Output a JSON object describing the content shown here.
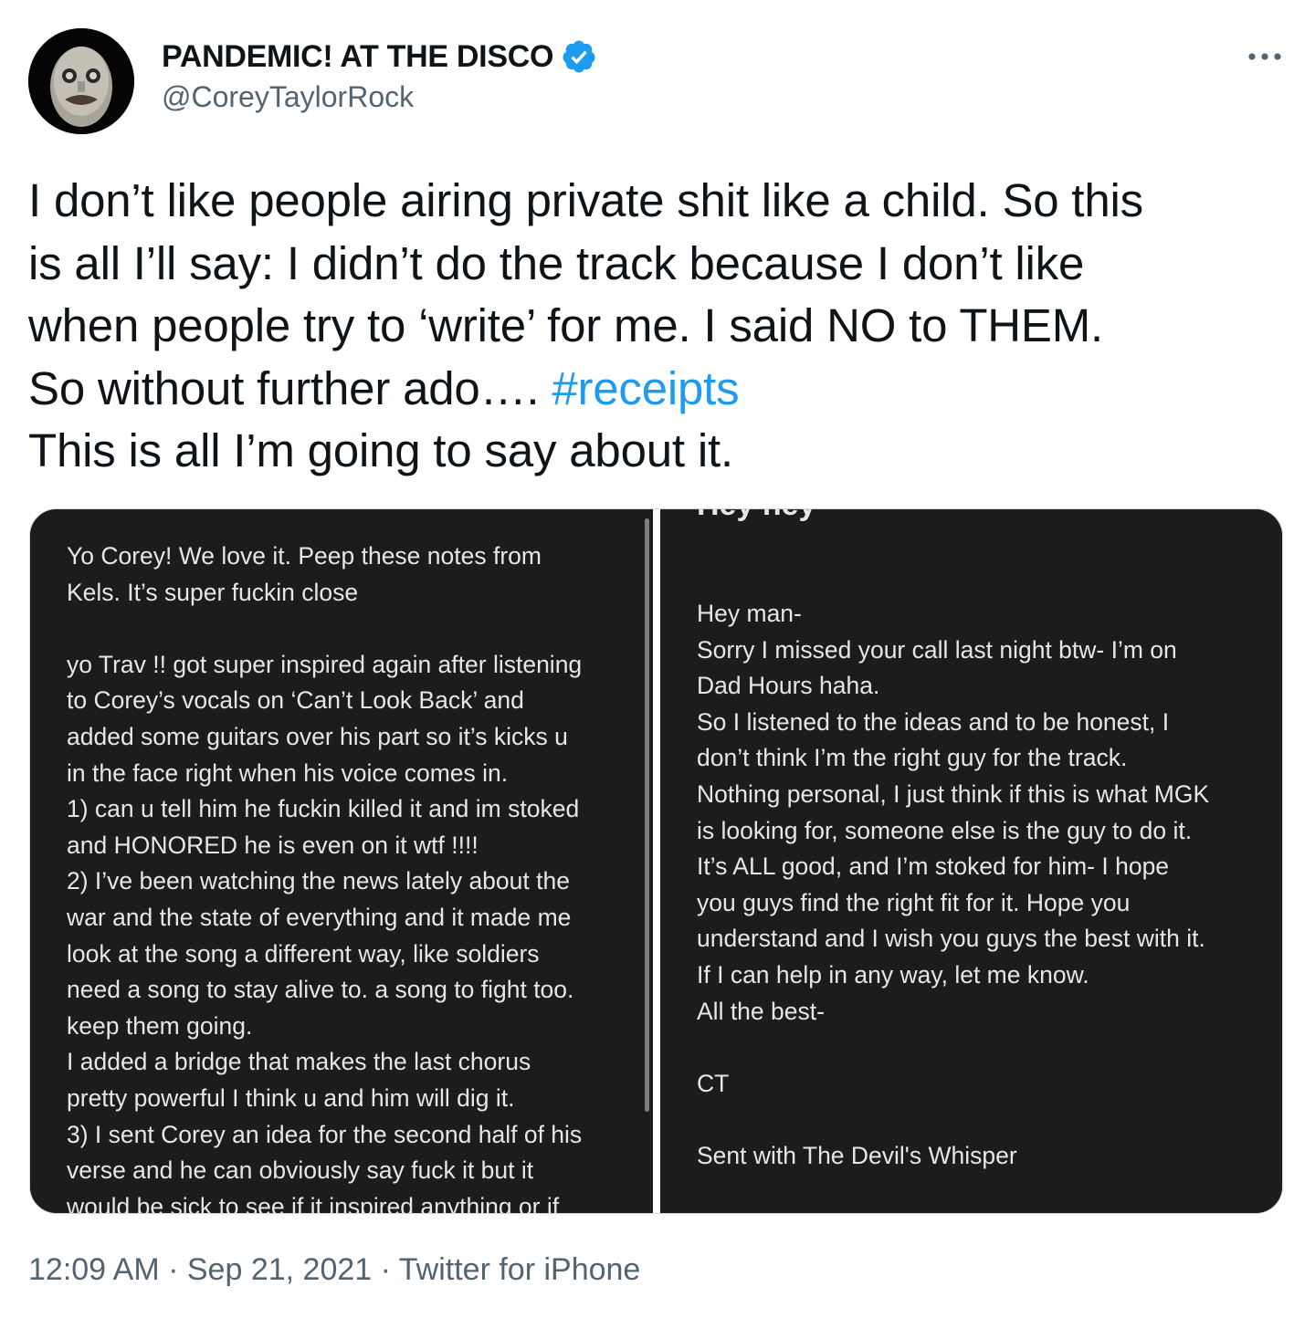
{
  "tweet": {
    "display_name": "PANDEMIC! AT THE DISCO",
    "handle": "@CoreyTaylorRock",
    "verified_icon": "verified-badge-icon",
    "more_icon": "more-options-icon",
    "text_lines": [
      "I don’t like people airing private shit like a child. So this",
      "is all I’ll say: I didn’t do the track because I don’t like",
      "when people try to ‘write’ for me. I said NO to THEM.",
      "So without further ado…. ",
      "This is all I’m going to say about it."
    ],
    "hashtag": "#receipts",
    "time": "12:09 AM",
    "date": "Sep 21, 2021",
    "source": "Twitter for iPhone",
    "separator": " · ",
    "colors": {
      "link": "#1d9bf0",
      "secondary": "#536471",
      "verified": "#1d9bf0"
    }
  },
  "media": {
    "left_panel_lines": [
      "Yo Corey! We love it. Peep these notes from",
      "Kels. It’s super fuckin close",
      "",
      "yo Trav !! got super inspired again after listening",
      "to Corey’s vocals on ‘Can’t Look Back’ and",
      "added some guitars over his part so it’s kicks u",
      "in the face right when his voice comes in.",
      "1) can u tell him he fuckin killed it and im stoked",
      "and HONORED he is even on it wtf !!!!",
      "2) I’ve been watching the news lately about the",
      "war and the state of everything and it made me",
      "look at the song a different way, like soldiers",
      "need a song to stay alive to. a song to fight too.",
      "keep them going.",
      "I added a bridge that makes the last chorus",
      "pretty powerful I think u and him will dig it.",
      "3) I sent Corey an idea for the second half of his",
      "verse and he can obviously say fuck it but it",
      "would be sick to see if it inspired anything or if"
    ],
    "right_panel_header": "Hey hey",
    "right_panel_lines": [
      "Hey man-",
      "Sorry I missed your call last night btw- I’m on",
      "Dad Hours haha.",
      "So I listened to the ideas and to be honest, I",
      "don’t think I’m the right guy for the track.",
      "Nothing personal, I just think if this is what MGK",
      "is looking for, someone else is the guy to do it.",
      "It’s ALL good, and I’m stoked for him- I hope",
      "you guys find the right fit for it. Hope you",
      "understand and I wish you guys the best with it.",
      "If I can help in any way, let me know.",
      "All the best-",
      "",
      "CT",
      "",
      "Sent with The Devil's Whisper"
    ]
  }
}
